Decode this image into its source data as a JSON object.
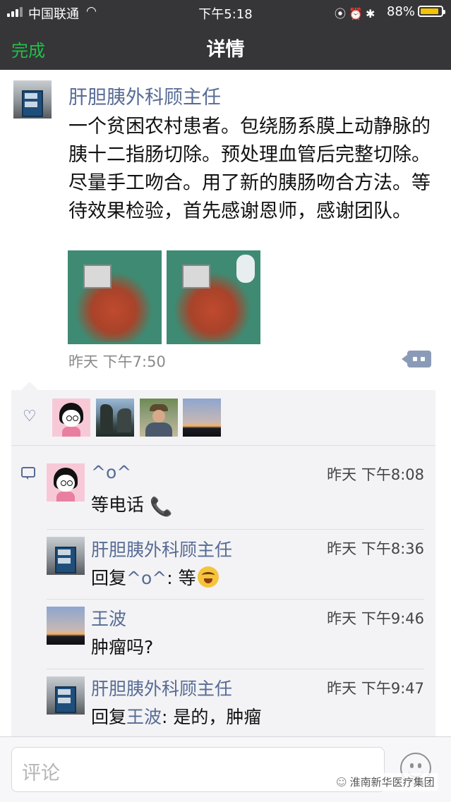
{
  "status_bar": {
    "carrier": "中国联通",
    "time": "下午5:18",
    "battery_percent": "88%",
    "battery_level": 0.88,
    "battery_color": "#f5c400",
    "icons": [
      "signal-icon",
      "wifi-icon",
      "orientation-lock-icon",
      "alarm-icon",
      "bluetooth-icon",
      "battery-icon"
    ]
  },
  "nav": {
    "done_label": "完成",
    "title": "详情",
    "accent_color": "#20c048"
  },
  "post": {
    "author": "肝胆胰外科顾主任",
    "content": "一个贫困农村患者。包绕肠系膜上动静脉的胰十二指肠切除。预处理血管后完整切除。尽量手工吻合。用了新的胰肠吻合方法。等待效果检验，首先感谢恩师，感谢团队。",
    "time": "昨天 下午7:50",
    "image_count": 2,
    "link_color": "#576b95"
  },
  "comments": [
    {
      "name": "^o^",
      "time": "昨天 下午8:08",
      "text": "等电话",
      "emoji": "📞"
    },
    {
      "name": "肝胆胰外科顾主任",
      "time": "昨天 下午8:36",
      "reply_prefix": "回复",
      "reply_to": "^o^",
      "text": ": 等"
    },
    {
      "name": "王波",
      "time": "昨天 下午9:46",
      "text": "肿瘤吗?"
    },
    {
      "name": "肝胆胰外科顾主任",
      "time": "昨天 下午9:47",
      "reply_prefix": "回复",
      "reply_to": "王波",
      "text": ": 是的，肿瘤"
    }
  ],
  "comment_bar": {
    "placeholder": "评论"
  },
  "watermark": "淮南新华医疗集团"
}
